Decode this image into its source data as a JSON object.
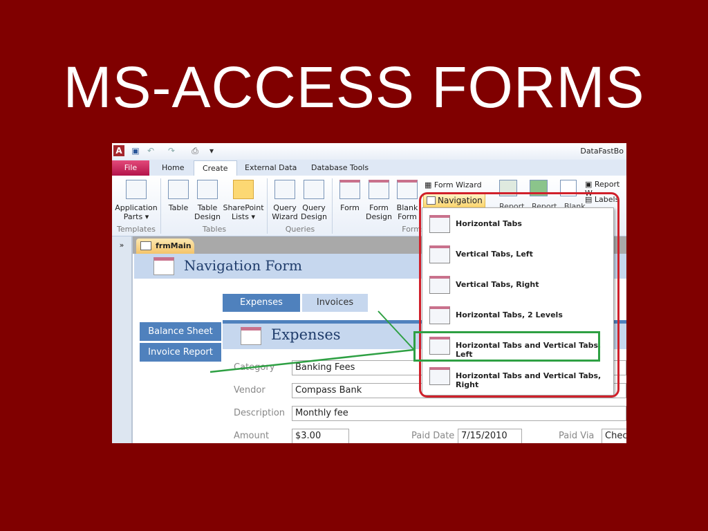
{
  "slide_title": "MS-ACCESS FORMS",
  "window": {
    "title": "DataFastBo",
    "qat_icons": [
      "access-logo-icon",
      "save-icon",
      "undo-icon",
      "redo-icon",
      "print-icon",
      "customize-icon"
    ]
  },
  "tabs": [
    "File",
    "Home",
    "Create",
    "External Data",
    "Database Tools"
  ],
  "active_tab": "Create",
  "ribbon": {
    "buttons": [
      {
        "l1": "Application",
        "l2": "Parts ▾"
      },
      {
        "l1": "Table",
        "l2": ""
      },
      {
        "l1": "Table",
        "l2": "Design"
      },
      {
        "l1": "SharePoint",
        "l2": "Lists ▾"
      },
      {
        "l1": "Query",
        "l2": "Wizard"
      },
      {
        "l1": "Query",
        "l2": "Design"
      },
      {
        "l1": "Form",
        "l2": ""
      },
      {
        "l1": "Form",
        "l2": "Design"
      },
      {
        "l1": "Blank",
        "l2": "Form"
      }
    ],
    "groups": [
      "Templates",
      "Tables",
      "Queries",
      "Forms"
    ],
    "form_wizard": "Form Wizard",
    "navigation": "Navigation ▾",
    "report_wizard": "Report W",
    "labels": "Labels",
    "report_partial": "Report   Report   Blank"
  },
  "navigation_menu": [
    "Horizontal Tabs",
    "Vertical Tabs, Left",
    "Vertical Tabs, Right",
    "Horizontal Tabs, 2 Levels",
    "Horizontal Tabs and Vertical Tabs, Left",
    "Horizontal Tabs and Vertical Tabs, Right"
  ],
  "highlighted_item": "Horizontal Tabs and Vertical Tabs, Left",
  "doc": {
    "expand_pane": "»",
    "doc_tab": "frmMain",
    "form_title": "Navigation Form",
    "top_tabs": [
      "Expenses",
      "Invoices"
    ],
    "side_tabs": [
      "Balance Sheet",
      "Invoice Report"
    ],
    "subform_title": "Expenses",
    "fields": {
      "category_label": "Category",
      "category": "Banking Fees",
      "vendor_label": "Vendor",
      "vendor": "Compass Bank",
      "description_label": "Description",
      "description": "Monthly fee",
      "amount_label": "Amount",
      "amount": "$3.00",
      "paid_date_label": "Paid Date",
      "paid_date": "7/15/2010",
      "paid_via_label": "Paid Via",
      "paid_via": "Chec"
    }
  },
  "colors": {
    "background": "#800000",
    "accent": "#4f81bd",
    "highlight_red": "#d0202a",
    "highlight_green": "#2ea043"
  }
}
